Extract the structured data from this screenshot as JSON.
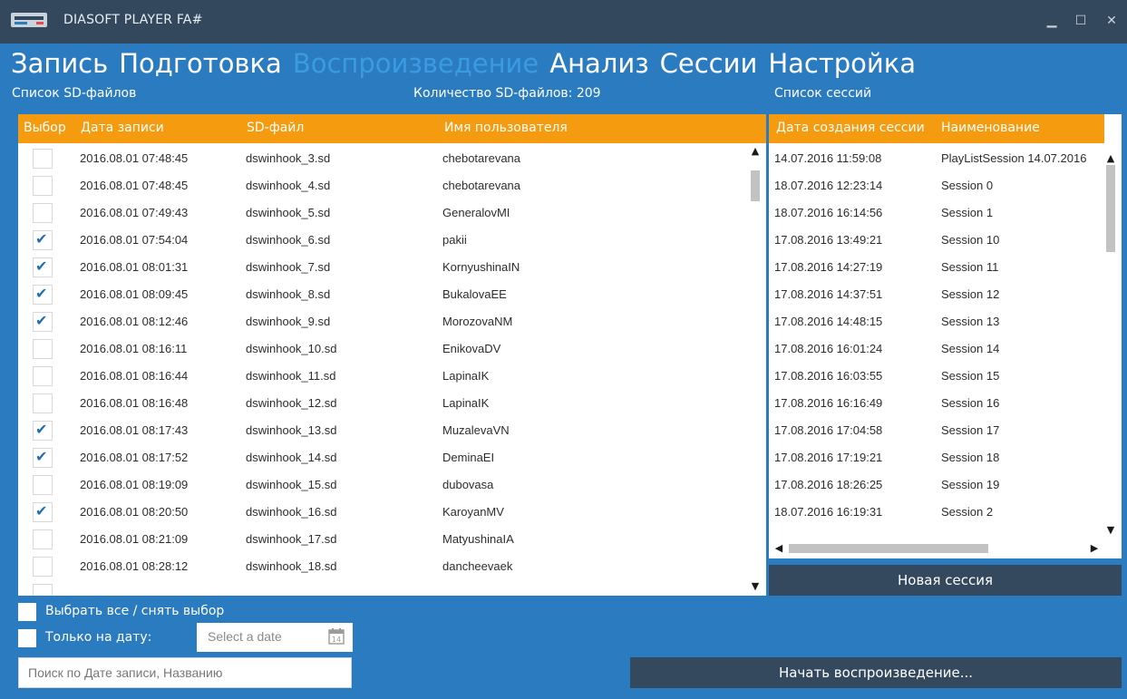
{
  "window": {
    "title": "DIASOFT PLAYER FA#",
    "minimize": "▁",
    "maximize": "☐",
    "close": "✕"
  },
  "nav": [
    "Запись",
    "Подготовка",
    "Воспроизведение",
    "Анализ",
    "Сессии",
    "Настройка"
  ],
  "nav_active": 2,
  "files": {
    "title": "Список SD-файлов",
    "count_label": "Количество SD-файлов: 209",
    "columns": [
      "Выбор",
      "Дата записи",
      "SD-файл",
      "Имя пользователя"
    ],
    "rows": [
      {
        "checked": false,
        "date": "2016.08.01 07:48:45",
        "file": "dswinhook_3.sd",
        "user": "chebotarevana"
      },
      {
        "checked": false,
        "date": "2016.08.01 07:48:45",
        "file": "dswinhook_4.sd",
        "user": "chebotarevana"
      },
      {
        "checked": false,
        "date": "2016.08.01 07:49:43",
        "file": "dswinhook_5.sd",
        "user": "GeneralovMI"
      },
      {
        "checked": true,
        "date": "2016.08.01 07:54:04",
        "file": "dswinhook_6.sd",
        "user": "pakii"
      },
      {
        "checked": true,
        "date": "2016.08.01 08:01:31",
        "file": "dswinhook_7.sd",
        "user": "KornyushinaIN"
      },
      {
        "checked": true,
        "date": "2016.08.01 08:09:45",
        "file": "dswinhook_8.sd",
        "user": "BukalovaEE"
      },
      {
        "checked": true,
        "date": "2016.08.01 08:12:46",
        "file": "dswinhook_9.sd",
        "user": "MorozovaNM"
      },
      {
        "checked": false,
        "date": "2016.08.01 08:16:11",
        "file": "dswinhook_10.sd",
        "user": "EnikovaDV"
      },
      {
        "checked": false,
        "date": "2016.08.01 08:16:44",
        "file": "dswinhook_11.sd",
        "user": "LapinaIK"
      },
      {
        "checked": false,
        "date": "2016.08.01 08:16:48",
        "file": "dswinhook_12.sd",
        "user": "LapinaIK"
      },
      {
        "checked": true,
        "date": "2016.08.01 08:17:43",
        "file": "dswinhook_13.sd",
        "user": "MuzalevaVN"
      },
      {
        "checked": true,
        "date": "2016.08.01 08:17:52",
        "file": "dswinhook_14.sd",
        "user": "DeminaEI"
      },
      {
        "checked": false,
        "date": "2016.08.01 08:19:09",
        "file": "dswinhook_15.sd",
        "user": "dubovasa"
      },
      {
        "checked": true,
        "date": "2016.08.01 08:20:50",
        "file": "dswinhook_16.sd",
        "user": "KaroyanMV"
      },
      {
        "checked": false,
        "date": "2016.08.01 08:21:09",
        "file": "dswinhook_17.sd",
        "user": "MatyushinaIA"
      },
      {
        "checked": false,
        "date": "2016.08.01 08:28:12",
        "file": "dswinhook_18.sd",
        "user": "dancheevaek"
      }
    ]
  },
  "sessions": {
    "title": "Список сессий",
    "columns": [
      "Дата создания сессии",
      "Наименование"
    ],
    "rows": [
      {
        "date": "14.07.2016 11:59:08",
        "name": "PlayListSession 14.07.2016"
      },
      {
        "date": "18.07.2016 12:23:14",
        "name": "Session 0"
      },
      {
        "date": "18.07.2016 16:14:56",
        "name": "Session 1"
      },
      {
        "date": "17.08.2016 13:49:21",
        "name": "Session 10"
      },
      {
        "date": "17.08.2016 14:27:19",
        "name": "Session 11"
      },
      {
        "date": "17.08.2016 14:37:51",
        "name": "Session 12"
      },
      {
        "date": "17.08.2016 14:48:15",
        "name": "Session 13"
      },
      {
        "date": "17.08.2016 16:01:24",
        "name": "Session 14"
      },
      {
        "date": "17.08.2016 16:03:55",
        "name": "Session 15"
      },
      {
        "date": "17.08.2016 16:16:49",
        "name": "Session 16"
      },
      {
        "date": "17.08.2016 17:04:58",
        "name": "Session 17"
      },
      {
        "date": "17.08.2016 17:19:21",
        "name": "Session 18"
      },
      {
        "date": "17.08.2016 18:26:25",
        "name": "Session 19"
      },
      {
        "date": "18.07.2016 16:19:31",
        "name": "Session 2"
      }
    ],
    "new_session_button": "Новая сессия"
  },
  "controls": {
    "select_all_label": "Выбрать все / снять выбор",
    "only_date_label": "Только на дату:",
    "date_placeholder": "Select a date",
    "search_placeholder": "Поиск по Дате записи, Названию",
    "start_button": "Начать воспроизведение..."
  },
  "colors": {
    "bg": "#2b7bc0",
    "titlebar": "#33485d",
    "header": "#f49b0f",
    "button": "#34495e",
    "active_tab": "#3b9be0",
    "check": "#1f6fb6"
  }
}
